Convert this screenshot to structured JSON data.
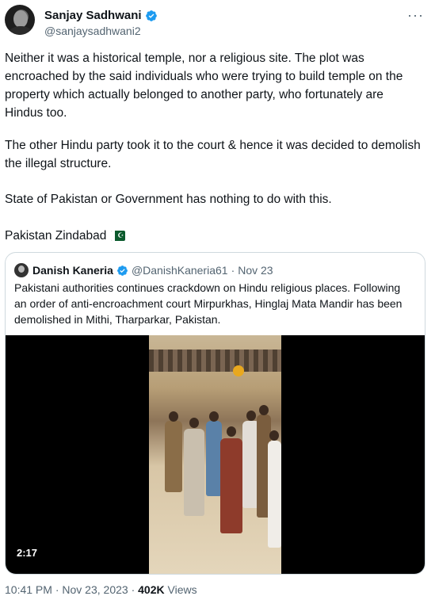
{
  "author": {
    "display_name": "Sanjay Sadhwani",
    "handle": "@sanjaysadhwani2",
    "verified_badge_color": "#1d9bf0"
  },
  "more_icon": "more-icon",
  "tweet": {
    "paragraph1": "Neither it was a historical temple, nor a religious site. The plot was encroached by the said individuals who were trying to build temple on the property which actually belonged to another party, who fortunately are Hindus too.",
    "paragraph2": "The other Hindu party took it to the court & hence it was decided to demolish the illegal structure.",
    "paragraph3": "State of Pakistan or Government has nothing to do with this.",
    "paragraph4": "Pakistan Zindabad",
    "flag_icon": "pakistan-flag-icon"
  },
  "quote": {
    "display_name": "Danish Kaneria",
    "handle": "@DanishKaneria61",
    "separator": "·",
    "date": "Nov 23",
    "text": "Pakistani authorities continues crackdown on Hindu religious places. Following an order of anti-encroachment court Mirpurkhas, Hinglaj Mata Mandir has been demolished in Mithi, Tharparkar, Pakistan.",
    "video_duration": "2:17"
  },
  "footer": {
    "time": "10:41 PM",
    "separator": "·",
    "date": "Nov 23, 2023",
    "views_count": "402K",
    "views_label": "Views"
  }
}
